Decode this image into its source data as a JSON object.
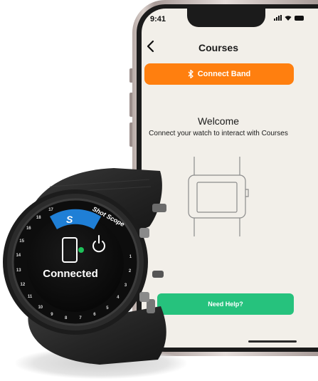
{
  "phone": {
    "status_time": "9:41",
    "title": "Courses",
    "back_icon": "chevron-left-icon",
    "connect_button": {
      "label": "Connect Band",
      "icon": "bluetooth-icon",
      "color": "#ff7f0f"
    },
    "welcome_title": "Welcome",
    "welcome_subtitle": "Connect your watch to interact with Courses",
    "illustration": "watch-outline-icon",
    "help_button": {
      "label": "Need Help?",
      "color": "#26c27d"
    }
  },
  "watch": {
    "brand": "Shot Scope",
    "logo_letter": "S",
    "status_text": "Connected",
    "status_dot_color": "#1ec25a",
    "power_icon": "power-icon",
    "device_icon": "phone-outline-icon",
    "bezel_numbers": [
      "17",
      "18",
      "16",
      "15",
      "14",
      "13",
      "12",
      "11",
      "10",
      "9",
      "8",
      "7",
      "6",
      "5",
      "4",
      "3",
      "2",
      "1"
    ]
  }
}
